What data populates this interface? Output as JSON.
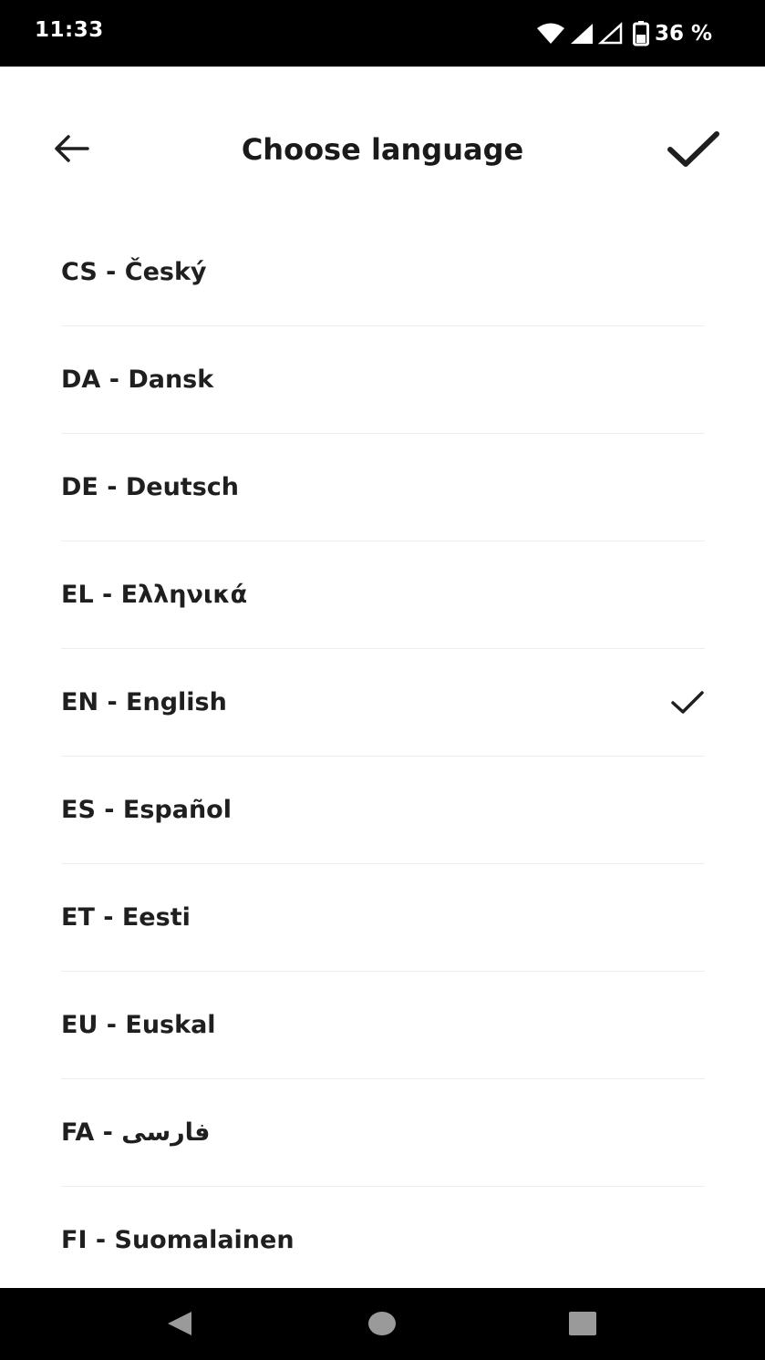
{
  "status_bar": {
    "time": "11:33",
    "battery": "36 %",
    "icons": [
      "wifi-icon",
      "signal-icon",
      "signal-outline-icon",
      "battery-icon"
    ]
  },
  "header": {
    "title": "Choose language",
    "back_icon": "arrow-left-icon",
    "confirm_icon": "checkmark-icon"
  },
  "languages": [
    {
      "label": "CS - Český",
      "selected": false
    },
    {
      "label": "DA - Dansk",
      "selected": false
    },
    {
      "label": "DE - Deutsch",
      "selected": false
    },
    {
      "label": "EL - Ελληνικά",
      "selected": false
    },
    {
      "label": "EN - English",
      "selected": true
    },
    {
      "label": "ES - Español",
      "selected": false
    },
    {
      "label": "ET - Eesti",
      "selected": false
    },
    {
      "label": "EU - Euskal",
      "selected": false
    },
    {
      "label": "FA - فارسی",
      "selected": false
    },
    {
      "label": "FI - Suomalainen",
      "selected": false
    }
  ],
  "nav_bar": {
    "icons": [
      "back-triangle-icon",
      "home-circle-icon",
      "recents-square-icon"
    ]
  },
  "colors": {
    "text": "#1f1f1f",
    "divider": "#ededed",
    "bars": "#000000",
    "nav_icons": "#9a9a9a"
  }
}
